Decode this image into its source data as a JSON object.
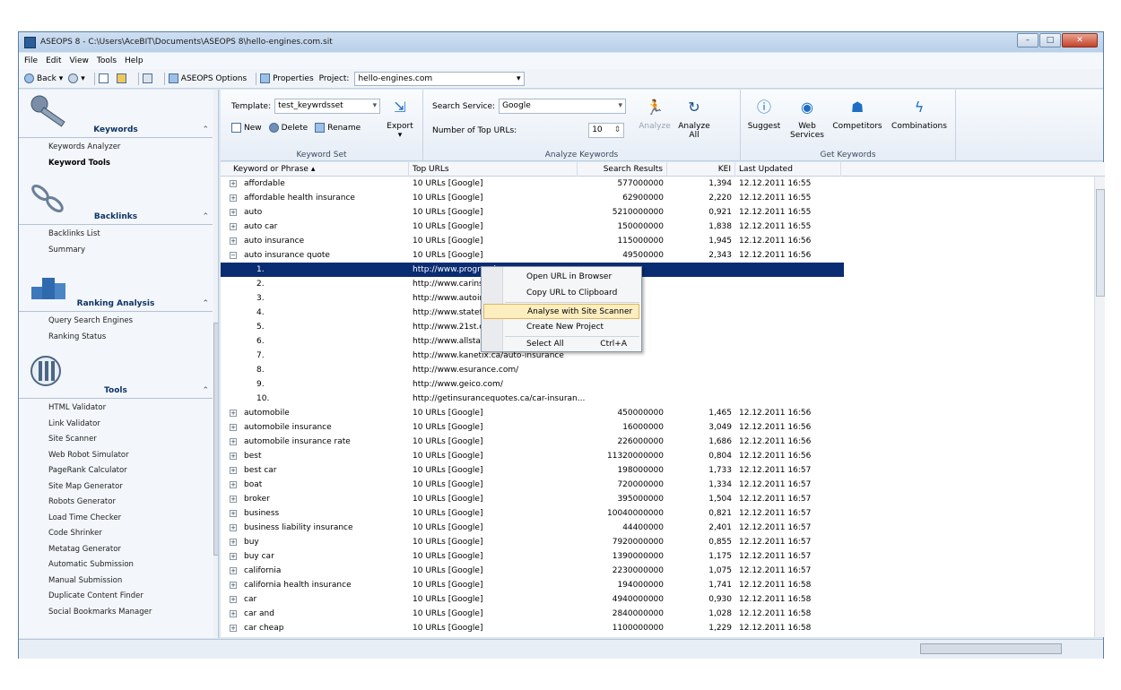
{
  "window": {
    "title": "ASEOPS 8 - C:\\Users\\AceBIT\\Documents\\ASEOPS 8\\hello-engines.com.sit"
  },
  "menu": [
    "File",
    "Edit",
    "View",
    "Tools",
    "Help"
  ],
  "toolbar": {
    "back": "Back",
    "options": "ASEOPS Options",
    "properties": "Properties",
    "project_label": "Project:",
    "project_value": "hello-engines.com"
  },
  "sidebar": {
    "sections": [
      {
        "title": "Keywords",
        "icon": "key-icon",
        "items": [
          {
            "label": "Keywords Analyzer",
            "bold": false
          },
          {
            "label": "Keyword Tools",
            "bold": true
          }
        ]
      },
      {
        "title": "Backlinks",
        "icon": "chain-link-icon",
        "items": [
          {
            "label": "Backlinks List",
            "bold": false
          },
          {
            "label": "Summary",
            "bold": false
          }
        ]
      },
      {
        "title": "Ranking Analysis",
        "icon": "podium-icon",
        "items": [
          {
            "label": "Query Search Engines",
            "bold": false
          },
          {
            "label": "Ranking Status",
            "bold": false
          }
        ]
      },
      {
        "title": "Tools",
        "icon": "tools-icon",
        "items": [
          {
            "label": "HTML Validator",
            "bold": false
          },
          {
            "label": "Link Validator",
            "bold": false
          },
          {
            "label": "Site Scanner",
            "bold": false
          },
          {
            "label": "Web Robot Simulator",
            "bold": false
          },
          {
            "label": "PageRank Calculator",
            "bold": false
          },
          {
            "label": "Site Map Generator",
            "bold": false
          },
          {
            "label": "Robots Generator",
            "bold": false
          },
          {
            "label": "Load Time Checker",
            "bold": false
          },
          {
            "label": "Code Shrinker",
            "bold": false
          },
          {
            "label": "Metatag Generator",
            "bold": false
          },
          {
            "label": "Automatic Submission",
            "bold": false
          },
          {
            "label": "Manual Submission",
            "bold": false
          },
          {
            "label": "Duplicate Content Finder",
            "bold": false
          },
          {
            "label": "Social Bookmarks Manager",
            "bold": false
          }
        ]
      }
    ]
  },
  "ribbon": {
    "keyword_set": {
      "template_label": "Template:",
      "template_value": "test_keywrdsset",
      "new": "New",
      "delete": "Delete",
      "rename": "Rename",
      "export": "Export",
      "group": "Keyword Set"
    },
    "analyze": {
      "service_label": "Search Service:",
      "service_value": "Google",
      "top_urls_label": "Number of Top URLs:",
      "top_urls_value": "10",
      "analyze": "Analyze",
      "analyze_all": "Analyze All",
      "group": "Analyze Keywords"
    },
    "get": {
      "suggest": "Suggest",
      "web_services": "Web Services",
      "competitors": "Competitors",
      "combinations": "Combinations",
      "group": "Get Keywords"
    }
  },
  "grid": {
    "columns": [
      "Keyword or Phrase",
      "Top URLs",
      "Search Results",
      "KEI",
      "Last Updated"
    ],
    "rows": [
      {
        "type": "kw",
        "kw": "affordable",
        "urls": "10 URLs [Google]",
        "results": "577000000",
        "kei": "1,394",
        "updated": "12.12.2011 16:55"
      },
      {
        "type": "kw",
        "kw": "affordable health insurance",
        "urls": "10 URLs [Google]",
        "results": "62900000",
        "kei": "2,220",
        "updated": "12.12.2011 16:55"
      },
      {
        "type": "kw",
        "kw": "auto",
        "urls": "10 URLs [Google]",
        "results": "5210000000",
        "kei": "0,921",
        "updated": "12.12.2011 16:55"
      },
      {
        "type": "kw",
        "kw": "auto car",
        "urls": "10 URLs [Google]",
        "results": "150000000",
        "kei": "1,838",
        "updated": "12.12.2011 16:55"
      },
      {
        "type": "kw",
        "kw": "auto insurance",
        "urls": "10 URLs [Google]",
        "results": "115000000",
        "kei": "1,945",
        "updated": "12.12.2011 16:56"
      },
      {
        "type": "kw",
        "kw": "auto insurance quote",
        "urls": "10 URLs [Google]",
        "results": "49500000",
        "kei": "2,343",
        "updated": "12.12.2011 16:56",
        "expanded": true
      },
      {
        "type": "url",
        "n": "1.",
        "url": "http://www.progressive",
        "sel": true
      },
      {
        "type": "url",
        "n": "2.",
        "url": "http://www.carinsuranc"
      },
      {
        "type": "url",
        "n": "3.",
        "url": "http://www.autoinsurar"
      },
      {
        "type": "url",
        "n": "4.",
        "url": "http://www.statefarm.c"
      },
      {
        "type": "url",
        "n": "5.",
        "url": "http://www.21st.com/"
      },
      {
        "type": "url",
        "n": "6.",
        "url": "http://www.allstate.com"
      },
      {
        "type": "url",
        "n": "7.",
        "url": "http://www.kanetix.ca/auto-insurance"
      },
      {
        "type": "url",
        "n": "8.",
        "url": "http://www.esurance.com/"
      },
      {
        "type": "url",
        "n": "9.",
        "url": "http://www.geico.com/"
      },
      {
        "type": "url",
        "n": "10.",
        "url": "http://getinsurancequotes.ca/car-insuran..."
      },
      {
        "type": "kw",
        "kw": "automobile",
        "urls": "10 URLs [Google]",
        "results": "450000000",
        "kei": "1,465",
        "updated": "12.12.2011 16:56"
      },
      {
        "type": "kw",
        "kw": "automobile insurance",
        "urls": "10 URLs [Google]",
        "results": "16000000",
        "kei": "3,049",
        "updated": "12.12.2011 16:56"
      },
      {
        "type": "kw",
        "kw": "automobile insurance rate",
        "urls": "10 URLs [Google]",
        "results": "226000000",
        "kei": "1,686",
        "updated": "12.12.2011 16:56"
      },
      {
        "type": "kw",
        "kw": "best",
        "urls": "10 URLs [Google]",
        "results": "11320000000",
        "kei": "0,804",
        "updated": "12.12.2011 16:56"
      },
      {
        "type": "kw",
        "kw": "best car",
        "urls": "10 URLs [Google]",
        "results": "198000000",
        "kei": "1,733",
        "updated": "12.12.2011 16:57"
      },
      {
        "type": "kw",
        "kw": "boat",
        "urls": "10 URLs [Google]",
        "results": "720000000",
        "kei": "1,334",
        "updated": "12.12.2011 16:57"
      },
      {
        "type": "kw",
        "kw": "broker",
        "urls": "10 URLs [Google]",
        "results": "395000000",
        "kei": "1,504",
        "updated": "12.12.2011 16:57"
      },
      {
        "type": "kw",
        "kw": "business",
        "urls": "10 URLs [Google]",
        "results": "10040000000",
        "kei": "0,821",
        "updated": "12.12.2011 16:57"
      },
      {
        "type": "kw",
        "kw": "business liability insurance",
        "urls": "10 URLs [Google]",
        "results": "44400000",
        "kei": "2,401",
        "updated": "12.12.2011 16:57"
      },
      {
        "type": "kw",
        "kw": "buy",
        "urls": "10 URLs [Google]",
        "results": "7920000000",
        "kei": "0,855",
        "updated": "12.12.2011 16:57"
      },
      {
        "type": "kw",
        "kw": "buy car",
        "urls": "10 URLs [Google]",
        "results": "1390000000",
        "kei": "1,175",
        "updated": "12.12.2011 16:57"
      },
      {
        "type": "kw",
        "kw": "california",
        "urls": "10 URLs [Google]",
        "results": "2230000000",
        "kei": "1,075",
        "updated": "12.12.2011 16:57"
      },
      {
        "type": "kw",
        "kw": "california health insurance",
        "urls": "10 URLs [Google]",
        "results": "194000000",
        "kei": "1,741",
        "updated": "12.12.2011 16:58"
      },
      {
        "type": "kw",
        "kw": "car",
        "urls": "10 URLs [Google]",
        "results": "4940000000",
        "kei": "0,930",
        "updated": "12.12.2011 16:58"
      },
      {
        "type": "kw",
        "kw": "car and",
        "urls": "10 URLs [Google]",
        "results": "2840000000",
        "kei": "1,028",
        "updated": "12.12.2011 16:58"
      },
      {
        "type": "kw",
        "kw": "car cheap",
        "urls": "10 URLs [Google]",
        "results": "1100000000",
        "kei": "1,229",
        "updated": "12.12.2011 16:58"
      }
    ]
  },
  "context_menu": {
    "items": [
      {
        "label": "Open URL in Browser",
        "shortcut": ""
      },
      {
        "label": "Copy URL to Clipboard",
        "shortcut": ""
      },
      {
        "label": "Analyse with Site Scanner",
        "shortcut": "",
        "highlighted": true
      },
      {
        "label": "Create New Project",
        "shortcut": ""
      },
      {
        "label": "Select All",
        "shortcut": "Ctrl+A"
      }
    ]
  }
}
